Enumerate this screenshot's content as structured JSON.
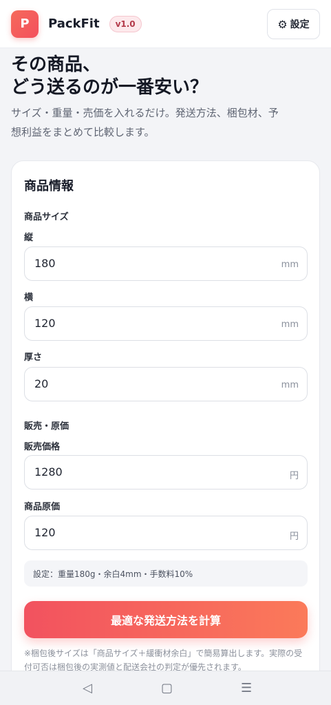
{
  "header": {
    "logo_letter": "P",
    "app_name": "PackFit",
    "version": "v1.0",
    "settings_label": "設定"
  },
  "hero": {
    "title_line1": "その商品、",
    "title_line2": "どう送るのが一番安い？",
    "subtitle": "サイズ・重量・売価を入れるだけ。発送方法、梱包材、予想利益をまとめて比較します。"
  },
  "card": {
    "title": "商品情報",
    "size_section": "商品サイズ",
    "fields": {
      "length": {
        "label": "縦",
        "value": "180",
        "unit": "mm"
      },
      "width": {
        "label": "横",
        "value": "120",
        "unit": "mm"
      },
      "thickness": {
        "label": "厚さ",
        "value": "20",
        "unit": "mm"
      },
      "price": {
        "label": "販売価格",
        "value": "1280",
        "unit": "円"
      },
      "cost": {
        "label": "商品原価",
        "value": "120",
        "unit": "円"
      }
    },
    "price_section": "販売・原価",
    "settings_note": "設定：重量180g・余白4mm・手数料10%",
    "calc_button": "最適な発送方法を計算",
    "disclaimer": "※梱包後サイズは「商品サイズ＋緩衝材余白」で簡易算出します。実際の受付可否は梱包後の実測値と配送会社の判定が優先されます。"
  },
  "navbar": {
    "back_icon": "◁",
    "home_icon": "▢",
    "menu_icon": "☰"
  }
}
